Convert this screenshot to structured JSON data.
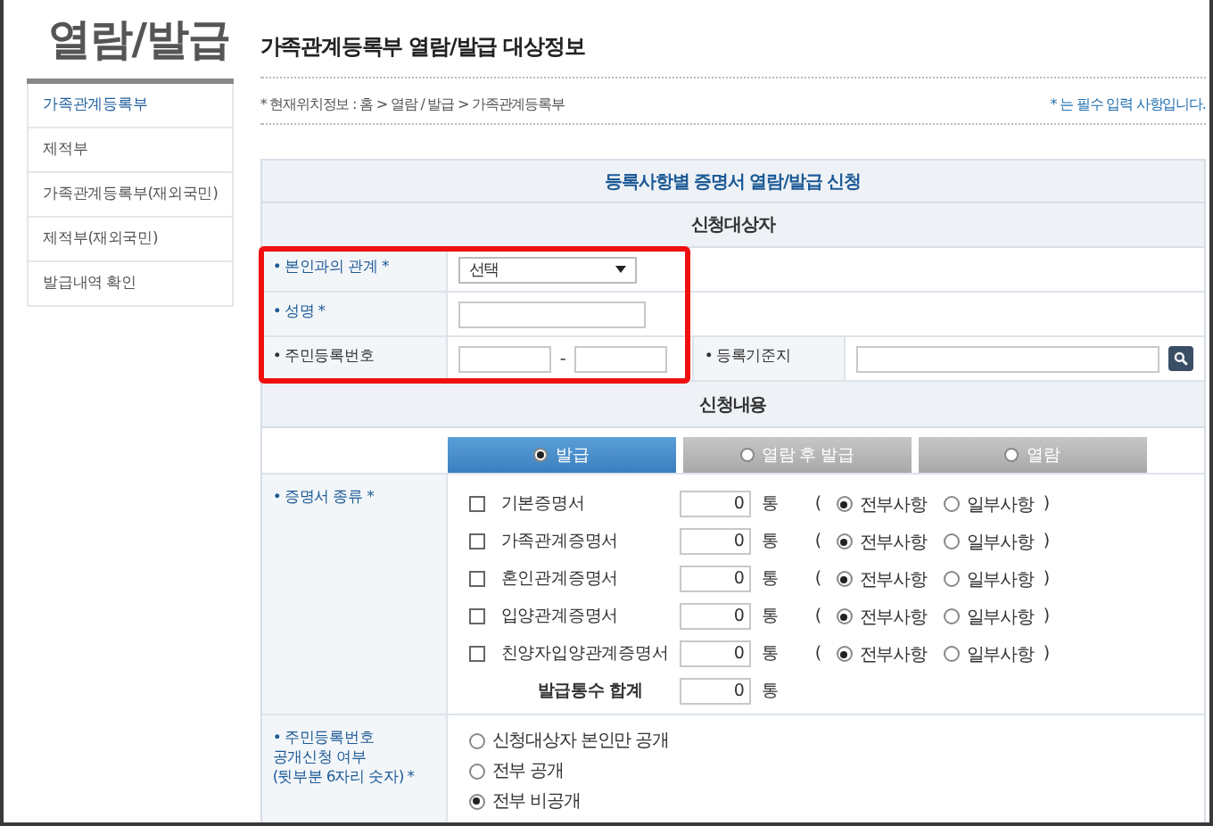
{
  "sidebar": {
    "title": "열람/발급",
    "items": [
      {
        "label": "가족관계등록부",
        "selected": true
      },
      {
        "label": "제적부",
        "selected": false
      },
      {
        "label": "가족관계등록부(재외국민)",
        "selected": false
      },
      {
        "label": "제적부(재외국민)",
        "selected": false
      },
      {
        "label": "발급내역 확인",
        "selected": false
      }
    ]
  },
  "page_title": "가족관계등록부 열람/발급 대상정보",
  "breadcrumb": "* 현재위치정보 : 홈 > 열람 / 발급 > 가족관계등록부",
  "required_note": "* 는 필수 입력 사항입니다.",
  "form": {
    "title": "등록사항별 증명서 열람/발급 신청",
    "target_section": "신청대상자",
    "relation": {
      "label": "• 본인과의 관계 *",
      "required": true,
      "value": "선택"
    },
    "name": {
      "label": "• 성명 *",
      "required": true
    },
    "rrn": {
      "label": "• 주민등록번호",
      "required": false,
      "separator": "-"
    },
    "base_place": {
      "label": "• 등록기준지",
      "required": false
    },
    "content_section": "신청내용",
    "modes": [
      {
        "label": "발급",
        "selected": true
      },
      {
        "label": "열람 후 발급",
        "selected": false
      },
      {
        "label": "열람",
        "selected": false
      }
    ],
    "cert_type": {
      "label": "• 증명서 종류 *",
      "required": true
    },
    "certificates": [
      {
        "name": "기본증명서",
        "checked": false,
        "count": "0",
        "unit": "통",
        "open": "(",
        "close": ")",
        "options": [
          {
            "label": "전부사항",
            "selected": true
          },
          {
            "label": "일부사항",
            "selected": false
          }
        ]
      },
      {
        "name": "가족관계증명서",
        "checked": false,
        "count": "0",
        "unit": "통",
        "open": "(",
        "close": ")",
        "options": [
          {
            "label": "전부사항",
            "selected": true
          },
          {
            "label": "일부사항",
            "selected": false
          }
        ]
      },
      {
        "name": "혼인관계증명서",
        "checked": false,
        "count": "0",
        "unit": "통",
        "open": "(",
        "close": ")",
        "options": [
          {
            "label": "전부사항",
            "selected": true
          },
          {
            "label": "일부사항",
            "selected": false
          }
        ]
      },
      {
        "name": "입양관계증명서",
        "checked": false,
        "count": "0",
        "unit": "통",
        "open": "(",
        "close": ")",
        "options": [
          {
            "label": "전부사항",
            "selected": true
          },
          {
            "label": "일부사항",
            "selected": false
          }
        ]
      },
      {
        "name": "친양자입양관계증명서",
        "checked": false,
        "count": "0",
        "unit": "통",
        "open": "(",
        "close": ")",
        "options": [
          {
            "label": "전부사항",
            "selected": true
          },
          {
            "label": "일부사항",
            "selected": false
          }
        ]
      }
    ],
    "total": {
      "label": "발급통수 합계",
      "count": "0",
      "unit": "통"
    },
    "disclosure": {
      "label": "• 주민등록번호\n공개신청 여부\n(뒷부분 6자리 숫자) *",
      "required": true,
      "options": [
        {
          "label": "신청대상자 본인만 공개",
          "selected": false
        },
        {
          "label": "전부 공개",
          "selected": false
        },
        {
          "label": "전부 비공개",
          "selected": true
        }
      ]
    }
  },
  "highlight_box": true
}
